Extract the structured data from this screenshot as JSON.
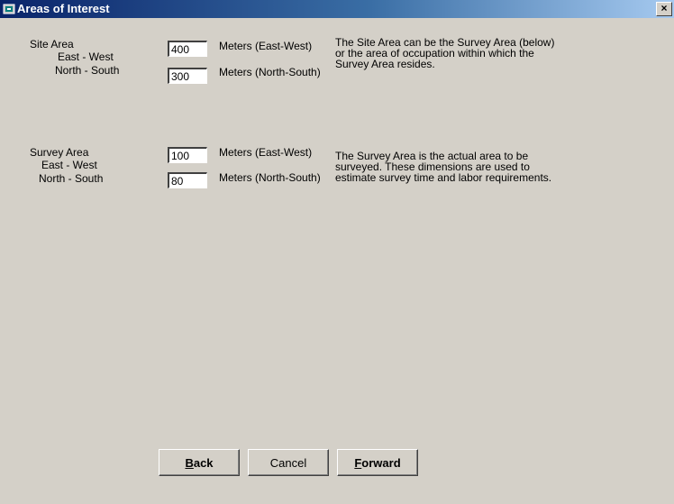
{
  "window": {
    "title": "Areas of Interest",
    "close_glyph": "×"
  },
  "site": {
    "heading": "Site Area",
    "ew_label": "East - West",
    "ns_label": "North - South",
    "ew_value": "400",
    "ns_value": "300",
    "ew_unit": "Meters (East-West)",
    "ns_unit": "Meters (North-South)",
    "description": [
      "The Site Area can be the Survey Area (below)",
      "or the area of occupation within which the",
      "Survey Area resides."
    ]
  },
  "survey": {
    "heading": "Survey Area",
    "ew_label": "East - West",
    "ns_label": "North - South",
    "ew_value": "100",
    "ns_value": "80",
    "ew_unit": "Meters (East-West)",
    "ns_unit": "Meters (North-South)",
    "description": [
      "The Survey Area is the actual area to be",
      "surveyed.  These dimensions are used to",
      "estimate survey  time and  labor requirements."
    ]
  },
  "buttons": {
    "back": {
      "accel": "B",
      "rest": "ack"
    },
    "cancel": "Cancel",
    "forward": {
      "accel": "F",
      "rest": "orward"
    }
  }
}
